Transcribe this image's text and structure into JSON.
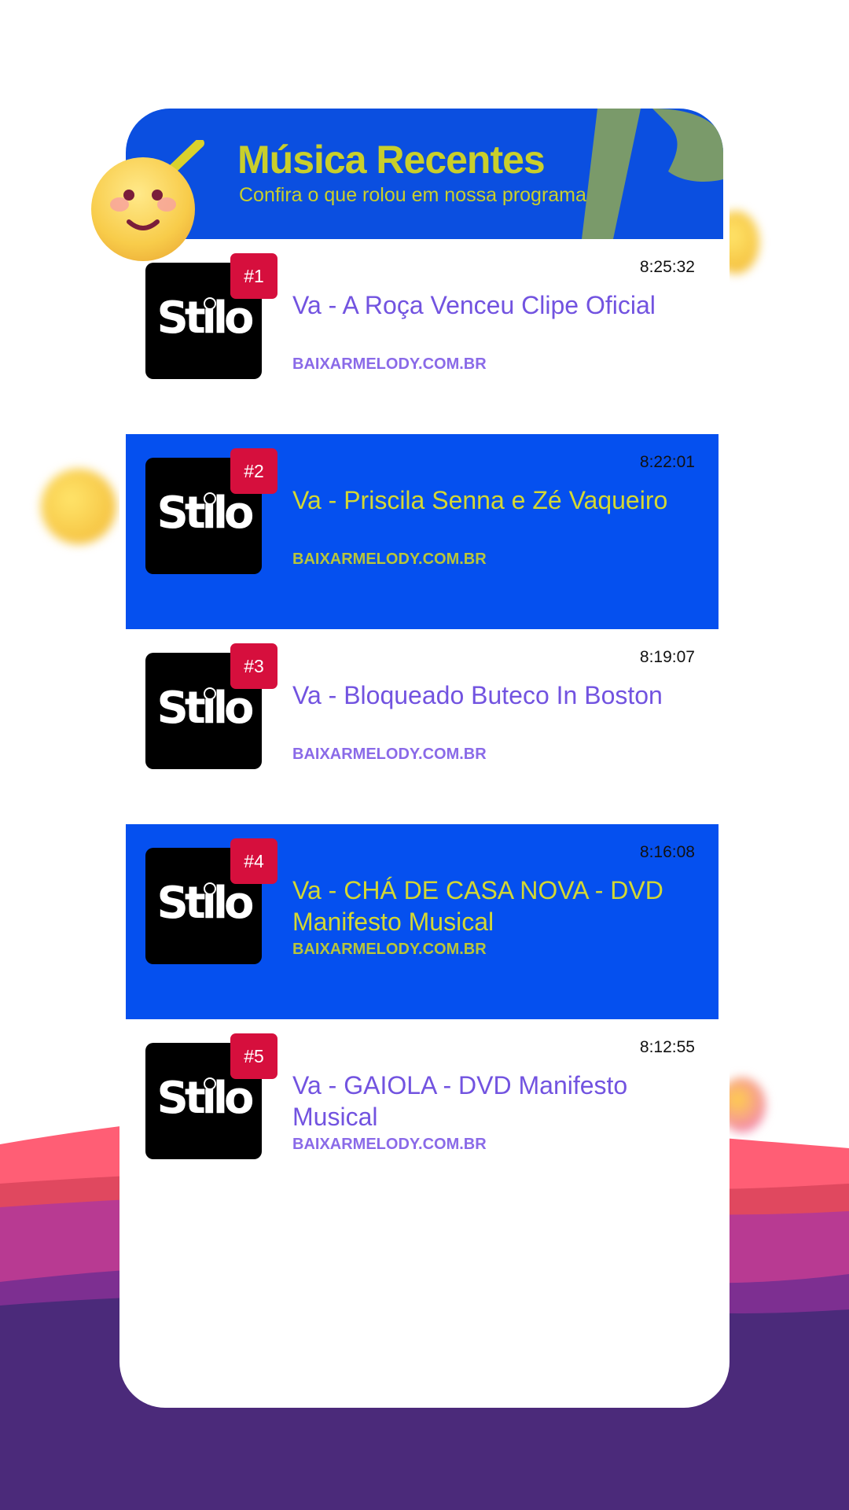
{
  "header": {
    "title": "Música Recentes",
    "subtitle": "Confira o que rolou em nossa programação"
  },
  "colors": {
    "header_bg": "#0b4fe0",
    "alt_row_bg": "#0550ef",
    "accent_yellow": "#c9cf2b",
    "title_purple": "#7253e0",
    "badge_red": "#d60f3d",
    "bg_purple": "#4b2a7a",
    "bg_pink": "#ff5a75"
  },
  "tracks": [
    {
      "rank": "#1",
      "cover_label": "Stilo",
      "time": "8:25:32",
      "title": "Va - A Roça Venceu Clipe Oficial",
      "source": "BAIXARMELODY.COM.BR"
    },
    {
      "rank": "#2",
      "cover_label": "Stilo",
      "time": "8:22:01",
      "title": "Va - Priscila Senna e Zé Vaqueiro",
      "source": "BAIXARMELODY.COM.BR"
    },
    {
      "rank": "#3",
      "cover_label": "Stilo",
      "time": "8:19:07",
      "title": "Va - Bloqueado Buteco In Boston",
      "source": "BAIXARMELODY.COM.BR"
    },
    {
      "rank": "#4",
      "cover_label": "Stilo",
      "time": "8:16:08",
      "title": "Va - CHÁ DE CASA NOVA - DVD Manifesto Musical",
      "source": "BAIXARMELODY.COM.BR"
    },
    {
      "rank": "#5",
      "cover_label": "Stilo",
      "time": "8:12:55",
      "title": "Va - GAIOLA - DVD Manifesto Musical",
      "source": "BAIXARMELODY.COM.BR"
    }
  ]
}
